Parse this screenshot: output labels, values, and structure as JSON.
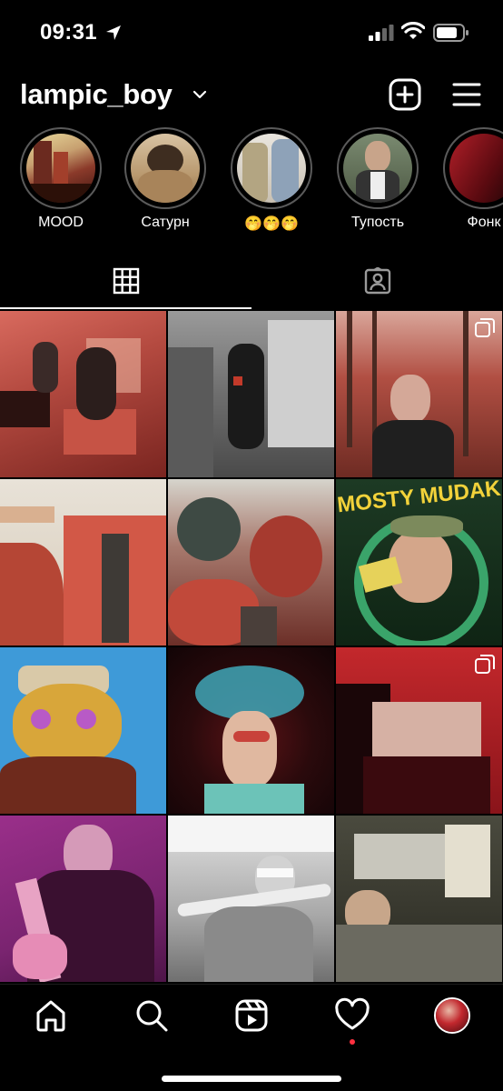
{
  "status_bar": {
    "time": "09:31"
  },
  "header": {
    "username": "lampic_boy"
  },
  "highlights": [
    {
      "label": "MOOD"
    },
    {
      "label": "Сатурн"
    },
    {
      "label": "🤭🤭🤭"
    },
    {
      "label": "Тупость"
    },
    {
      "label": "Фонк"
    }
  ],
  "tabs": [
    {
      "name": "posts-grid",
      "active": true
    },
    {
      "name": "tagged",
      "active": false
    }
  ],
  "posts_multi_flags": [
    false,
    false,
    true,
    false,
    false,
    false,
    false,
    false,
    true,
    false,
    false,
    false
  ],
  "post_4_text": "MOSTY MUDAK",
  "icons": {
    "status": [
      "location-arrow-icon",
      "signal-icon",
      "wifi-icon",
      "battery-icon"
    ],
    "header": [
      "chevron-down-icon",
      "add-post-icon",
      "menu-icon"
    ],
    "tabs": [
      "grid-icon",
      "tagged-person-icon"
    ],
    "nav": [
      "home-icon",
      "search-icon",
      "reels-icon",
      "heart-icon",
      "profile-avatar"
    ]
  },
  "colors": {
    "background": "#000000",
    "text": "#ffffff",
    "notification_dot": "#ff3040",
    "highlight_ring": "#5a5a5a"
  }
}
